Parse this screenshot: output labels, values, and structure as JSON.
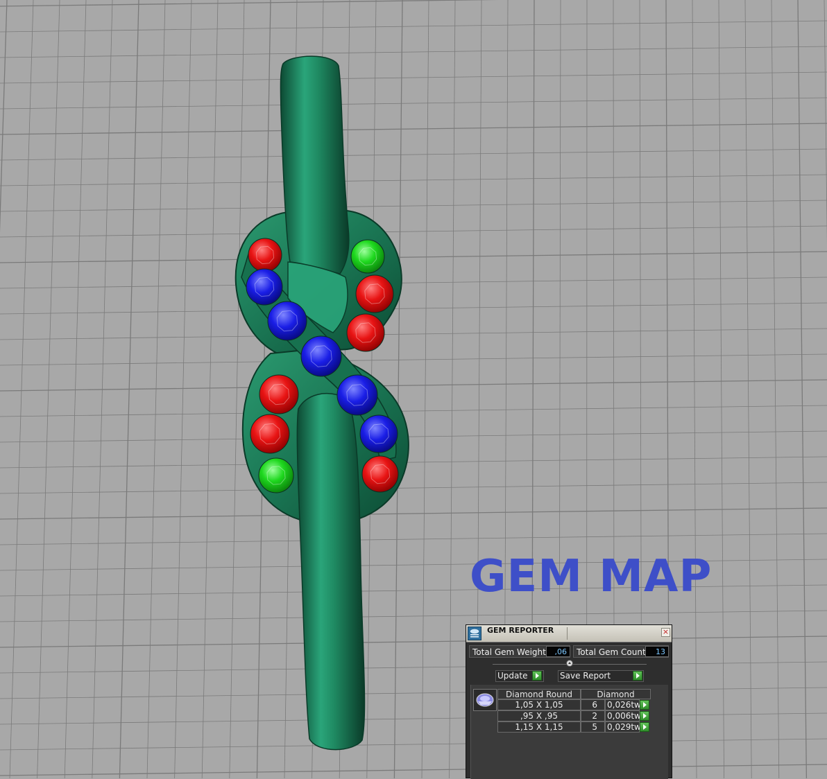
{
  "viewport": {
    "background_color": "#a8a8a8",
    "grid_color": "#7a7a7a",
    "model": {
      "metal_color": "#1e7a57",
      "gems": [
        {
          "color": "red"
        },
        {
          "color": "blue"
        },
        {
          "color": "blue"
        },
        {
          "color": "blue"
        },
        {
          "color": "red"
        },
        {
          "color": "red"
        },
        {
          "color": "green"
        },
        {
          "color": "green"
        },
        {
          "color": "red"
        },
        {
          "color": "red"
        },
        {
          "color": "blue"
        },
        {
          "color": "blue"
        },
        {
          "color": "red"
        }
      ]
    },
    "gem_colors": {
      "red": "#e01010",
      "blue": "#1418e0",
      "green": "#18d818"
    }
  },
  "overlay": {
    "title": "GEM MAP",
    "title_color": "#3e4fc8"
  },
  "panel": {
    "title": "GEM REPORTER",
    "close_icon": "close-icon",
    "total_weight_label": "Total Gem Weight",
    "total_weight_value": ",06",
    "total_count_label": "Total Gem Count",
    "total_count_value": "13",
    "update_label": "Update",
    "save_report_label": "Save Report",
    "table": {
      "headers": [
        "Diamond Round",
        "Diamond"
      ],
      "rows": [
        {
          "size": "1,05 X 1,05",
          "count": "6",
          "weight": "0,026tw"
        },
        {
          "size": ",95 X ,95",
          "count": "2",
          "weight": "0,006tw"
        },
        {
          "size": "1,15 X 1,15",
          "count": "5",
          "weight": "0,029tw"
        }
      ]
    }
  }
}
